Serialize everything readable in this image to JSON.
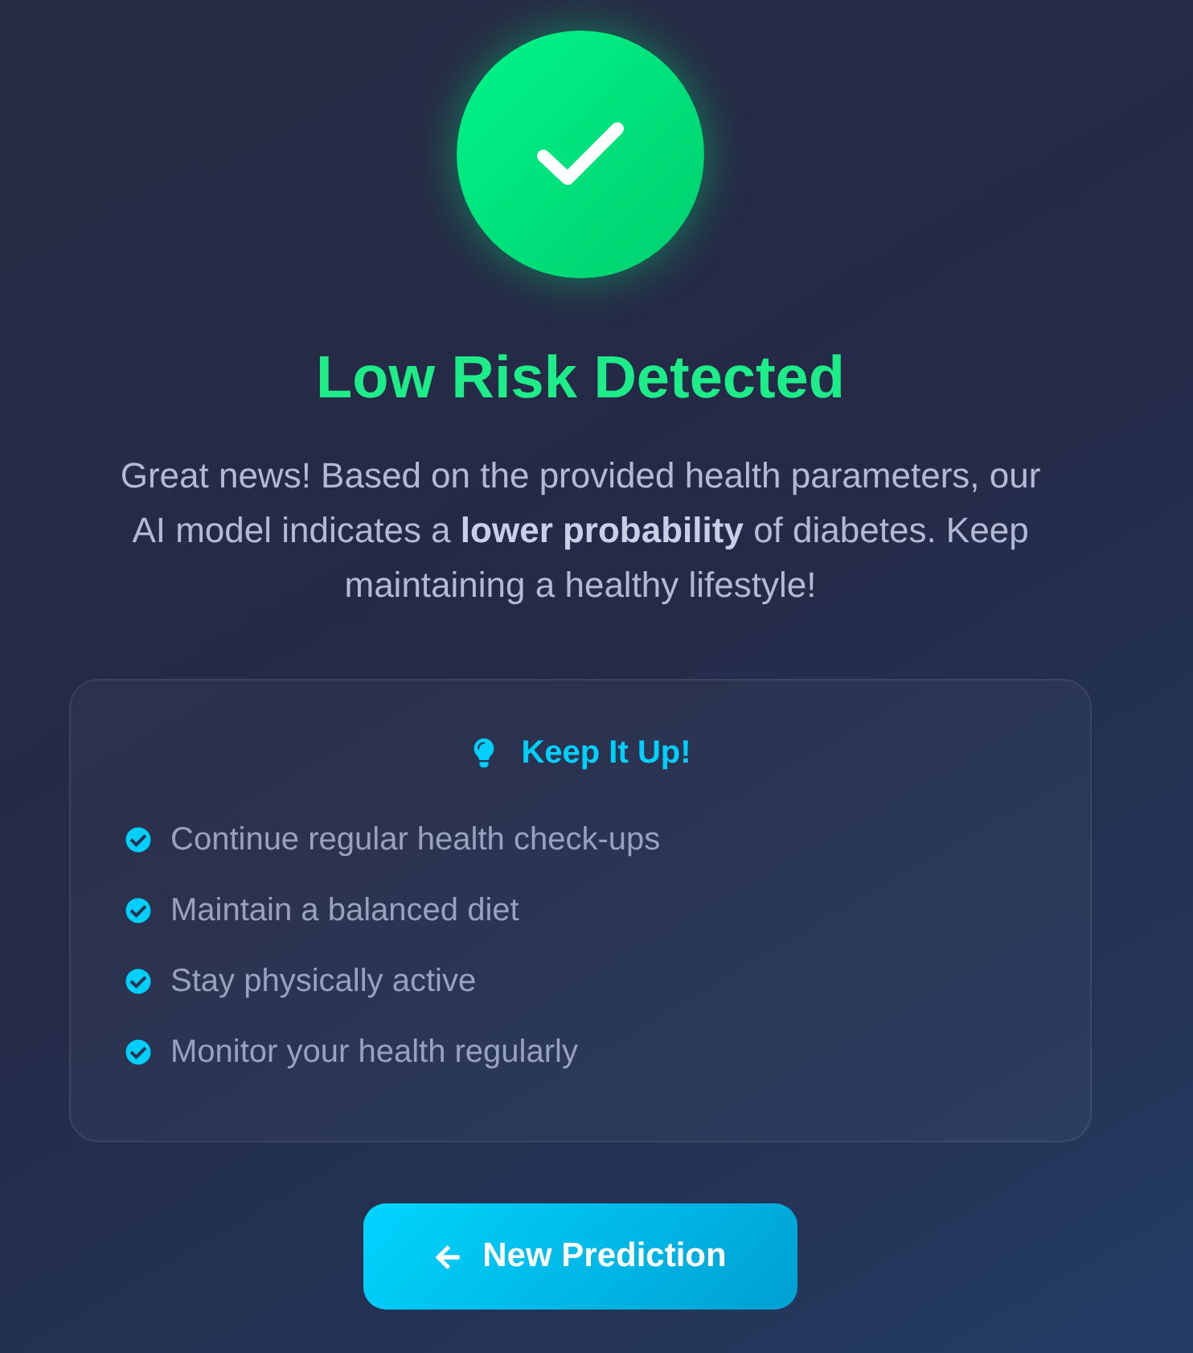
{
  "result": {
    "low_risk": true,
    "title": "Low Risk Detected",
    "message": "Great news! Based on the provided health parameters, our AI model indicates a **lower probability** of diabetes. Keep maintaining a healthy lifestyle!"
  },
  "tips": {
    "title": "Keep It Up!",
    "items": [
      "Continue regular health check-ups",
      "Maintain a balanced diet",
      "Stay physically active",
      "Monitor your health regularly"
    ]
  },
  "button": {
    "label": "New Prediction"
  }
}
